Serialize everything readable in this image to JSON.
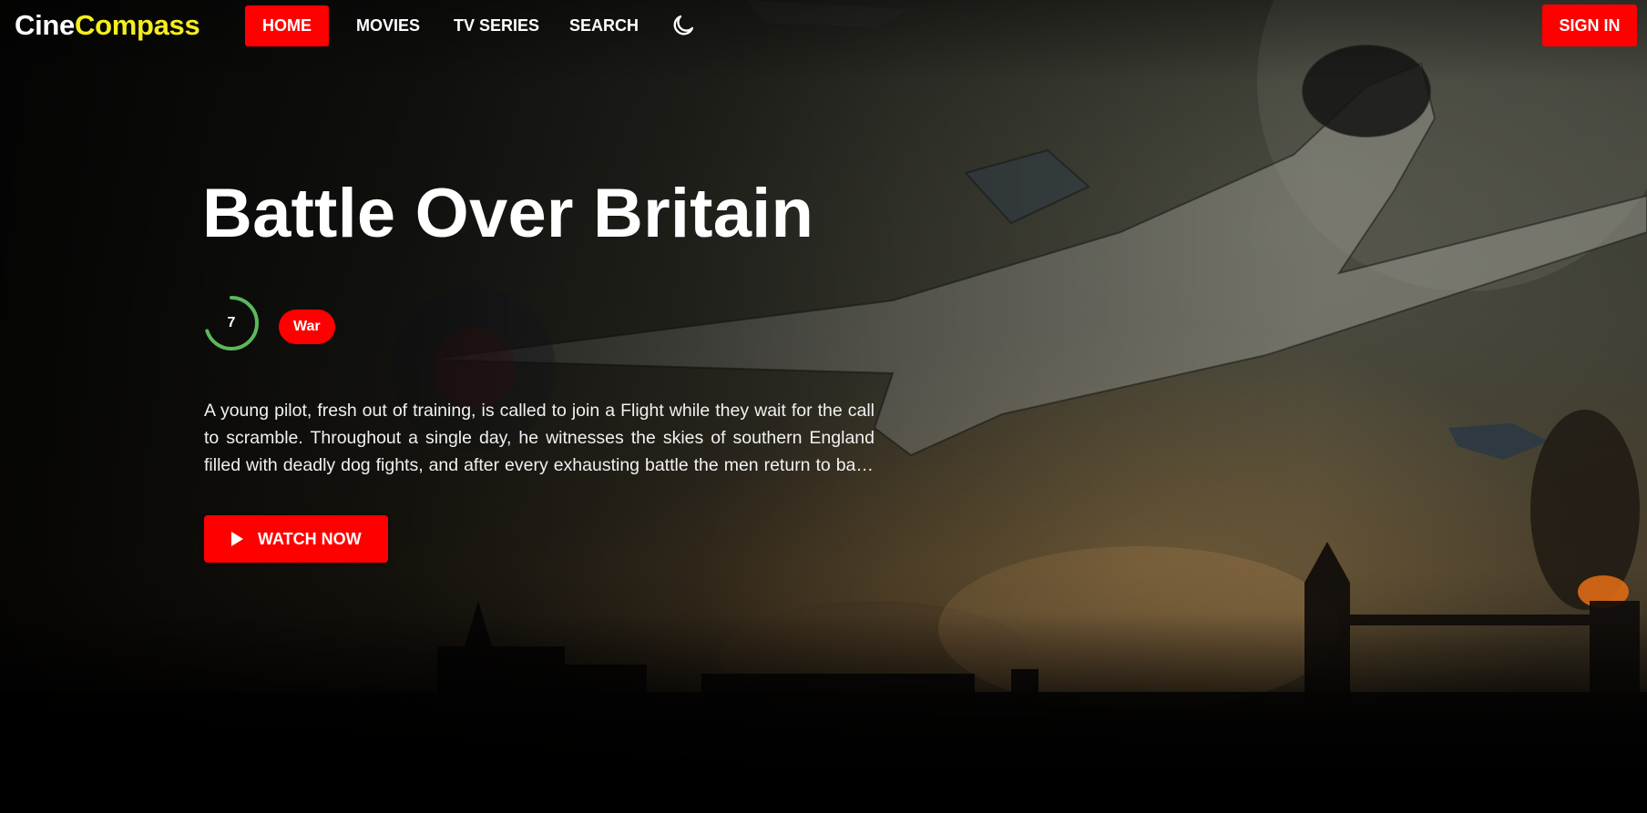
{
  "brand": {
    "part1": "Cine",
    "part2": "Compass"
  },
  "nav": {
    "home": "HOME",
    "movies": "MOVIES",
    "tv_series": "TV SERIES",
    "search": "SEARCH",
    "theme_icon": "moon-icon",
    "active": "home"
  },
  "auth": {
    "sign_in": "SIGN IN"
  },
  "hero": {
    "title": "Battle Over Britain",
    "rating": "7",
    "rating_fraction": 0.7,
    "genre": "War",
    "overview": "A young pilot, fresh out of training, is called to join a Flight while they wait for the call to scramble. Throughout a single day, he witnesses the skies of southern England filled with deadly dog fights, and after every exhausting battle the men return to base with fewer numbers.",
    "cta": "WATCH NOW",
    "cta_icon": "play-icon"
  },
  "colors": {
    "accent": "#ff0000",
    "brand_yellow": "#f5ee1e",
    "rating_ring": "#5cb85c"
  }
}
